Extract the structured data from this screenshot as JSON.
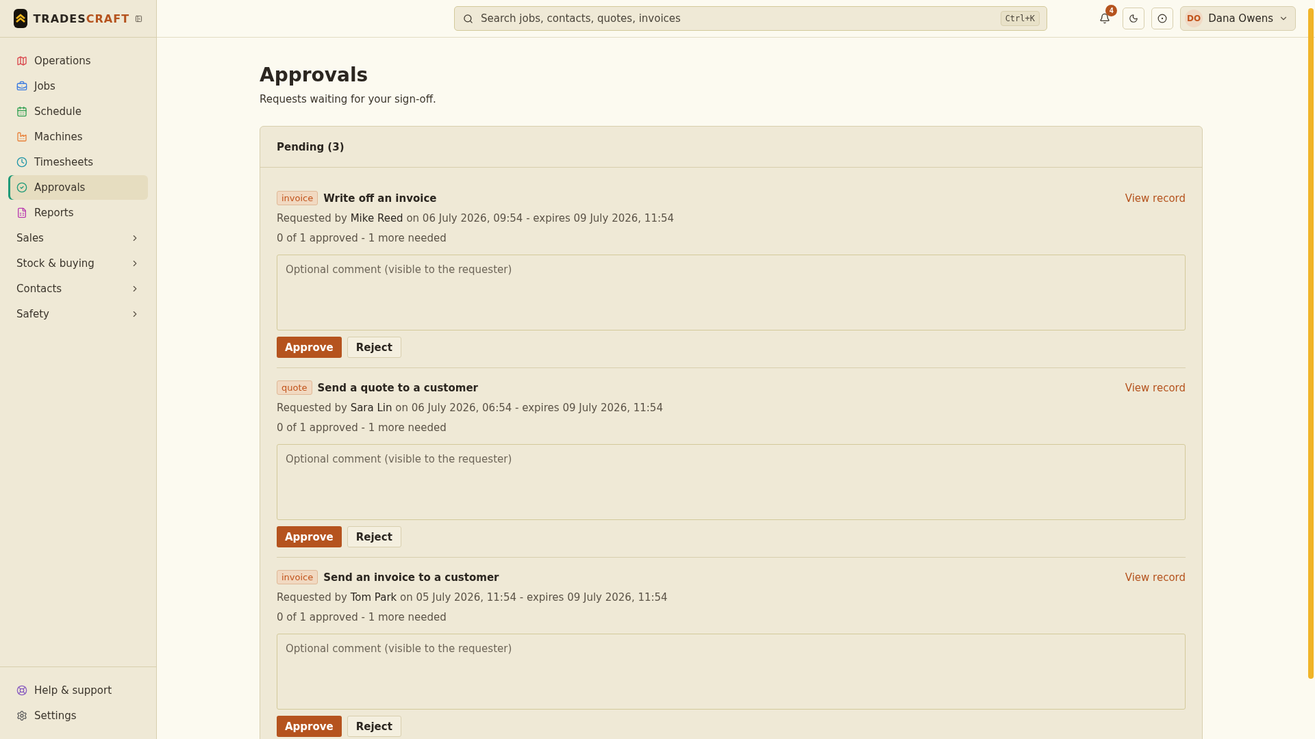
{
  "brand": {
    "primary": "TRADES",
    "accent": "CRAFT"
  },
  "search": {
    "placeholder": "Search jobs, contacts, quotes, invoices",
    "shortcut": "Ctrl+K"
  },
  "notifications": {
    "count": "4"
  },
  "user": {
    "initials": "DO",
    "name": "Dana Owens"
  },
  "sidebar": {
    "items": [
      {
        "kind": "link",
        "label": "Operations",
        "selected": false
      },
      {
        "kind": "link",
        "label": "Jobs",
        "selected": false
      },
      {
        "kind": "link",
        "label": "Schedule",
        "selected": false
      },
      {
        "kind": "link",
        "label": "Machines",
        "selected": false
      },
      {
        "kind": "link",
        "label": "Timesheets",
        "selected": false
      },
      {
        "kind": "link",
        "label": "Approvals",
        "selected": true
      },
      {
        "kind": "link",
        "label": "Reports",
        "selected": false
      },
      {
        "kind": "group",
        "label": "Sales",
        "selected": false
      },
      {
        "kind": "group",
        "label": "Stock & buying",
        "selected": false
      },
      {
        "kind": "group",
        "label": "Contacts",
        "selected": false
      },
      {
        "kind": "group",
        "label": "Safety",
        "selected": false
      }
    ],
    "footer": [
      {
        "label": "Help & support"
      },
      {
        "label": "Settings"
      }
    ]
  },
  "page": {
    "title": "Approvals",
    "subtitle": "Requests waiting for your sign-off."
  },
  "panel": {
    "heading": "Pending (3)",
    "requests": [
      {
        "tag": "invoice",
        "title": "Write off an invoice",
        "link": "View record",
        "prefix": "Requested by",
        "requester": "Mike Reed",
        "details": "on 06 July 2026, 09:54 - expires 09 July 2026, 11:54",
        "progress": "0 of 1 approved - 1 more needed",
        "placeholder": "Optional comment (visible to the requester)",
        "approve": "Approve",
        "reject": "Reject"
      },
      {
        "tag": "quote",
        "title": "Send a quote to a customer",
        "link": "View record",
        "prefix": "Requested by",
        "requester": "Sara Lin",
        "details": "on 06 July 2026, 06:54 - expires 09 July 2026, 11:54",
        "progress": "0 of 1 approved - 1 more needed",
        "placeholder": "Optional comment (visible to the requester)",
        "approve": "Approve",
        "reject": "Reject"
      },
      {
        "tag": "invoice",
        "title": "Send an invoice to a customer",
        "link": "View record",
        "prefix": "Requested by",
        "requester": "Tom Park",
        "details": "on 05 July 2026, 11:54 - expires 09 July 2026, 11:54",
        "progress": "0 of 1 approved - 1 more needed",
        "placeholder": "Optional comment (visible to the requester)",
        "approve": "Approve",
        "reject": "Reject"
      }
    ]
  }
}
